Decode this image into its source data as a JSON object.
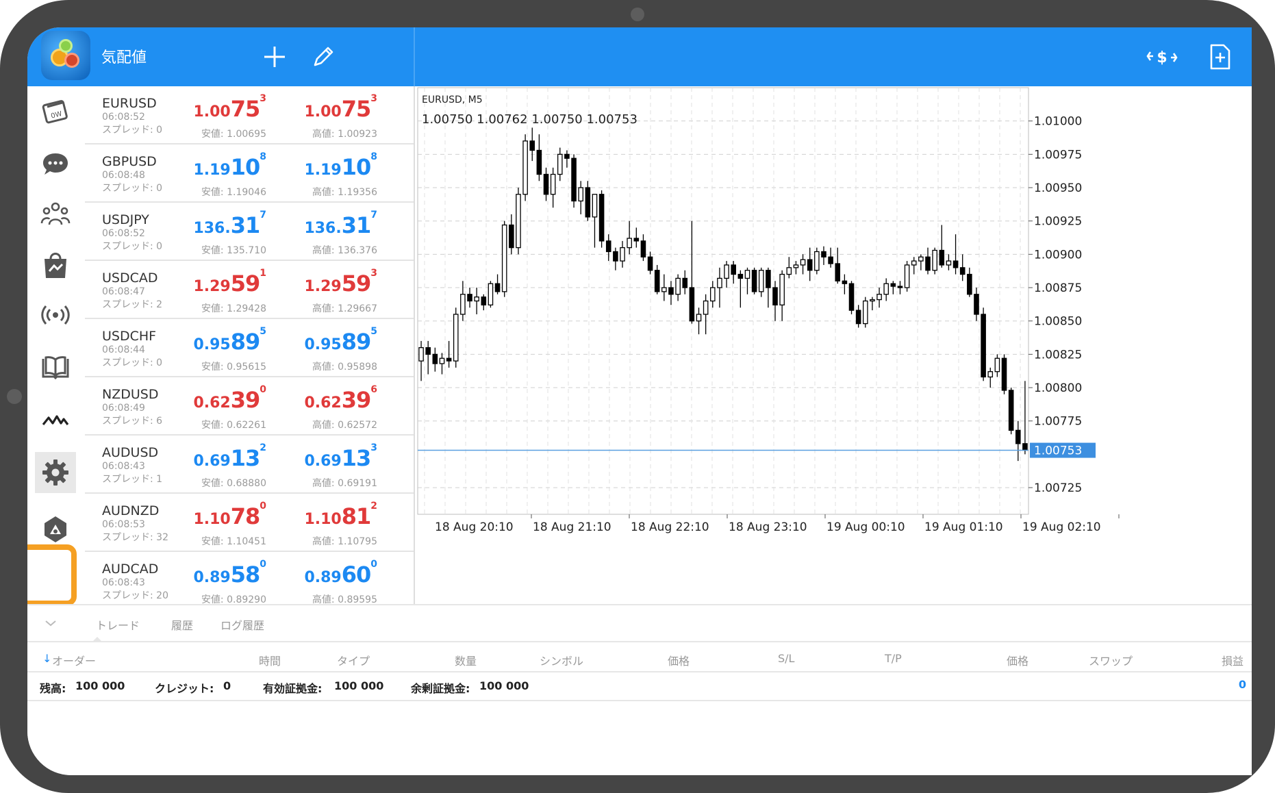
{
  "topbar": {
    "title": "気配値"
  },
  "quotes": [
    {
      "symbol": "EURUSD",
      "time": "06:08:52",
      "spread": "スプレッド: 0",
      "bid": {
        "p1": "1.00",
        "p2": "75",
        "p3": "3",
        "color": "red"
      },
      "ask": {
        "p1": "1.00",
        "p2": "75",
        "p3": "3",
        "color": "red"
      },
      "low": "安値: 1.00695",
      "high": "高値: 1.00923"
    },
    {
      "symbol": "GBPUSD",
      "time": "06:08:48",
      "spread": "スプレッド: 0",
      "bid": {
        "p1": "1.19",
        "p2": "10",
        "p3": "8",
        "color": "blue"
      },
      "ask": {
        "p1": "1.19",
        "p2": "10",
        "p3": "8",
        "color": "blue"
      },
      "low": "安値: 1.19046",
      "high": "高値: 1.19356"
    },
    {
      "symbol": "USDJPY",
      "time": "06:08:52",
      "spread": "スプレッド: 0",
      "bid": {
        "p1": "136.",
        "p2": "31",
        "p3": "7",
        "color": "blue"
      },
      "ask": {
        "p1": "136.",
        "p2": "31",
        "p3": "7",
        "color": "blue"
      },
      "low": "安値: 135.710",
      "high": "高値: 136.376"
    },
    {
      "symbol": "USDCAD",
      "time": "06:08:47",
      "spread": "スプレッド: 2",
      "bid": {
        "p1": "1.29",
        "p2": "59",
        "p3": "1",
        "color": "red"
      },
      "ask": {
        "p1": "1.29",
        "p2": "59",
        "p3": "3",
        "color": "red"
      },
      "low": "安値: 1.29428",
      "high": "高値: 1.29667"
    },
    {
      "symbol": "USDCHF",
      "time": "06:08:44",
      "spread": "スプレッド: 0",
      "bid": {
        "p1": "0.95",
        "p2": "89",
        "p3": "5",
        "color": "blue"
      },
      "ask": {
        "p1": "0.95",
        "p2": "89",
        "p3": "5",
        "color": "blue"
      },
      "low": "安値: 0.95615",
      "high": "高値: 0.95898"
    },
    {
      "symbol": "NZDUSD",
      "time": "06:08:49",
      "spread": "スプレッド: 6",
      "bid": {
        "p1": "0.62",
        "p2": "39",
        "p3": "0",
        "color": "red"
      },
      "ask": {
        "p1": "0.62",
        "p2": "39",
        "p3": "6",
        "color": "red"
      },
      "low": "安値: 0.62261",
      "high": "高値: 0.62572"
    },
    {
      "symbol": "AUDUSD",
      "time": "06:08:43",
      "spread": "スプレッド: 1",
      "bid": {
        "p1": "0.69",
        "p2": "13",
        "p3": "2",
        "color": "blue"
      },
      "ask": {
        "p1": "0.69",
        "p2": "13",
        "p3": "3",
        "color": "blue"
      },
      "low": "安値: 0.68880",
      "high": "高値: 0.69191"
    },
    {
      "symbol": "AUDNZD",
      "time": "06:08:53",
      "spread": "スプレッド: 32",
      "bid": {
        "p1": "1.10",
        "p2": "78",
        "p3": "0",
        "color": "red"
      },
      "ask": {
        "p1": "1.10",
        "p2": "81",
        "p3": "2",
        "color": "red"
      },
      "low": "安値: 1.10451",
      "high": "高値: 1.10795"
    },
    {
      "symbol": "AUDCAD",
      "time": "06:08:43",
      "spread": "スプレッド: 20",
      "bid": {
        "p1": "0.89",
        "p2": "58",
        "p3": "0",
        "color": "blue"
      },
      "ask": {
        "p1": "0.89",
        "p2": "60",
        "p3": "0",
        "color": "blue"
      },
      "low": "安値: 0.89290",
      "high": "高値: 0.89595"
    }
  ],
  "colors": {
    "accent": "#1f8ff2",
    "bid_red": "#e03a3a",
    "bid_blue": "#1c89f2",
    "highlight": "#f5a023"
  },
  "chart": {
    "symbol_label": "EURUSD, M5",
    "ohlc_label": "1.00750 1.00762 1.00750 1.00753",
    "current_price_label": "1.00753"
  },
  "chart_data": {
    "type": "candlestick",
    "title": "EURUSD, M5",
    "ylim": [
      1.00705,
      1.01025
    ],
    "y_ticks": [
      "1.01000",
      "1.00975",
      "1.00950",
      "1.00925",
      "1.00900",
      "1.00875",
      "1.00850",
      "1.00825",
      "1.00800",
      "1.00775",
      "1.00725"
    ],
    "x_ticks": [
      "18 Aug 20:10",
      "18 Aug 21:10",
      "18 Aug 22:10",
      "18 Aug 23:10",
      "19 Aug 00:10",
      "19 Aug 01:10",
      "19 Aug 02:10"
    ],
    "current_price": 1.00753,
    "grid": true,
    "candles": [
      [
        1.0082,
        1.00835,
        1.00805,
        1.0083
      ],
      [
        1.0083,
        1.00835,
        1.0081,
        1.00825
      ],
      [
        1.00825,
        1.0083,
        1.00812,
        1.00818
      ],
      [
        1.00818,
        1.00826,
        1.0081,
        1.00822
      ],
      [
        1.00822,
        1.00835,
        1.00815,
        1.0082
      ],
      [
        1.0082,
        1.0086,
        1.00815,
        1.00855
      ],
      [
        1.00855,
        1.0088,
        1.0085,
        1.0087
      ],
      [
        1.0087,
        1.00875,
        1.0086,
        1.00865
      ],
      [
        1.00865,
        1.00875,
        1.00855,
        1.00868
      ],
      [
        1.00868,
        1.0087,
        1.00858,
        1.00862
      ],
      [
        1.00862,
        1.0088,
        1.0086,
        1.00878
      ],
      [
        1.00878,
        1.00885,
        1.0087,
        1.00872
      ],
      [
        1.00872,
        1.00925,
        1.00868,
        1.00922
      ],
      [
        1.00922,
        1.0093,
        1.009,
        1.00905
      ],
      [
        1.00905,
        1.0095,
        1.009,
        1.00945
      ],
      [
        1.00945,
        1.0099,
        1.0094,
        1.00985
      ],
      [
        1.00985,
        1.00995,
        1.0097,
        1.00978
      ],
      [
        1.00978,
        1.0099,
        1.00955,
        1.0096
      ],
      [
        1.0096,
        1.00965,
        1.0094,
        1.00945
      ],
      [
        1.00945,
        1.00965,
        1.00935,
        1.0096
      ],
      [
        1.0096,
        1.0098,
        1.00955,
        1.00975
      ],
      [
        1.00975,
        1.00978,
        1.00965,
        1.00972
      ],
      [
        1.00972,
        1.00975,
        1.00935,
        1.0094
      ],
      [
        1.0094,
        1.00955,
        1.0093,
        1.0095
      ],
      [
        1.0095,
        1.00955,
        1.00925,
        1.00928
      ],
      [
        1.00928,
        1.00945,
        1.00905,
        1.00945
      ],
      [
        1.00945,
        1.00948,
        1.00905,
        1.0091
      ],
      [
        1.0091,
        1.00915,
        1.00895,
        1.00902
      ],
      [
        1.00902,
        1.00905,
        1.00888,
        1.00895
      ],
      [
        1.00895,
        1.0091,
        1.0089,
        1.00905
      ],
      [
        1.00905,
        1.00925,
        1.009,
        1.00912
      ],
      [
        1.00912,
        1.0092,
        1.00905,
        1.0091
      ],
      [
        1.0091,
        1.00915,
        1.00895,
        1.00898
      ],
      [
        1.00898,
        1.00902,
        1.00885,
        1.00888
      ],
      [
        1.00888,
        1.00892,
        1.0087,
        1.00872
      ],
      [
        1.00872,
        1.00885,
        1.00865,
        1.00875
      ],
      [
        1.00875,
        1.0088,
        1.00862,
        1.0087
      ],
      [
        1.0087,
        1.00885,
        1.00865,
        1.00882
      ],
      [
        1.00882,
        1.00888,
        1.0087,
        1.00875
      ],
      [
        1.00875,
        1.00925,
        1.00848,
        1.0085
      ],
      [
        1.0085,
        1.0086,
        1.0084,
        1.00855
      ],
      [
        1.00855,
        1.0087,
        1.0084,
        1.00865
      ],
      [
        1.00865,
        1.0088,
        1.0086,
        1.00875
      ],
      [
        1.00875,
        1.0089,
        1.0086,
        1.00882
      ],
      [
        1.00882,
        1.00895,
        1.00875,
        1.00892
      ],
      [
        1.00892,
        1.00895,
        1.00878,
        1.00885
      ],
      [
        1.00885,
        1.00888,
        1.0086,
        1.00882
      ],
      [
        1.00882,
        1.0089,
        1.0087,
        1.00888
      ],
      [
        1.00888,
        1.0089,
        1.0087,
        1.00872
      ],
      [
        1.00872,
        1.0089,
        1.00868,
        1.00888
      ],
      [
        1.00888,
        1.0089,
        1.0086,
        1.00875
      ],
      [
        1.00875,
        1.0088,
        1.0085,
        1.00862
      ],
      [
        1.00862,
        1.00888,
        1.0085,
        1.00885
      ],
      [
        1.00885,
        1.00898,
        1.00882,
        1.0089
      ],
      [
        1.0089,
        1.00895,
        1.00885,
        1.00892
      ],
      [
        1.00892,
        1.009,
        1.00885,
        1.00896
      ],
      [
        1.00896,
        1.00905,
        1.0088,
        1.00888
      ],
      [
        1.00888,
        1.00905,
        1.00885,
        1.00902
      ],
      [
        1.00902,
        1.00906,
        1.00892,
        1.00898
      ],
      [
        1.00898,
        1.00905,
        1.0089,
        1.00893
      ],
      [
        1.00893,
        1.00905,
        1.00878,
        1.0088
      ],
      [
        1.0088,
        1.00885,
        1.0087,
        1.00878
      ],
      [
        1.00878,
        1.0088,
        1.00855,
        1.00858
      ],
      [
        1.00858,
        1.00862,
        1.00845,
        1.00848
      ],
      [
        1.00848,
        1.00868,
        1.00845,
        1.00865
      ],
      [
        1.00865,
        1.00868,
        1.00858,
        1.00866
      ],
      [
        1.00866,
        1.00875,
        1.0086,
        1.0087
      ],
      [
        1.0087,
        1.00882,
        1.00865,
        1.00878
      ],
      [
        1.00878,
        1.0088,
        1.0087,
        1.00876
      ],
      [
        1.00876,
        1.0088,
        1.0087,
        1.00875
      ],
      [
        1.00875,
        1.00895,
        1.00872,
        1.00892
      ],
      [
        1.00892,
        1.00898,
        1.00885,
        1.00895
      ],
      [
        1.00895,
        1.009,
        1.00888,
        1.00898
      ],
      [
        1.00898,
        1.00905,
        1.00885,
        1.00888
      ],
      [
        1.00888,
        1.00905,
        1.00885,
        1.00903
      ],
      [
        1.00903,
        1.00922,
        1.0089,
        1.00892
      ],
      [
        1.00892,
        1.009,
        1.00888,
        1.00895
      ],
      [
        1.00895,
        1.00915,
        1.00885,
        1.0089
      ],
      [
        1.0089,
        1.009,
        1.0088,
        1.00885
      ],
      [
        1.00885,
        1.0089,
        1.00868,
        1.0087
      ],
      [
        1.0087,
        1.00875,
        1.0085,
        1.00855
      ],
      [
        1.00855,
        1.0086,
        1.00805,
        1.00808
      ],
      [
        1.00808,
        1.00815,
        1.008,
        1.00812
      ],
      [
        1.00812,
        1.00825,
        1.00808,
        1.00822
      ],
      [
        1.00822,
        1.00825,
        1.00795,
        1.00798
      ],
      [
        1.00798,
        1.008,
        1.00765,
        1.00768
      ],
      [
        1.00768,
        1.00775,
        1.00745,
        1.00758
      ],
      [
        1.00758,
        1.00805,
        1.0075,
        1.00753
      ]
    ]
  },
  "bottom": {
    "tabs": [
      "トレード",
      "履歴",
      "ログ履歴"
    ],
    "columns": [
      "オーダー",
      "時間",
      "タイプ",
      "数量",
      "シンボル",
      "価格",
      "S/L",
      "T/P",
      "価格",
      "スワップ",
      "損益"
    ],
    "account": {
      "balance_label": "残高:",
      "balance": "100 000",
      "credit_label": "クレジット:",
      "credit": "0",
      "equity_label": "有効証拠金:",
      "equity": "100 000",
      "free_margin_label": "余剰証拠金:",
      "free_margin": "100 000",
      "profit_total": "0"
    }
  }
}
